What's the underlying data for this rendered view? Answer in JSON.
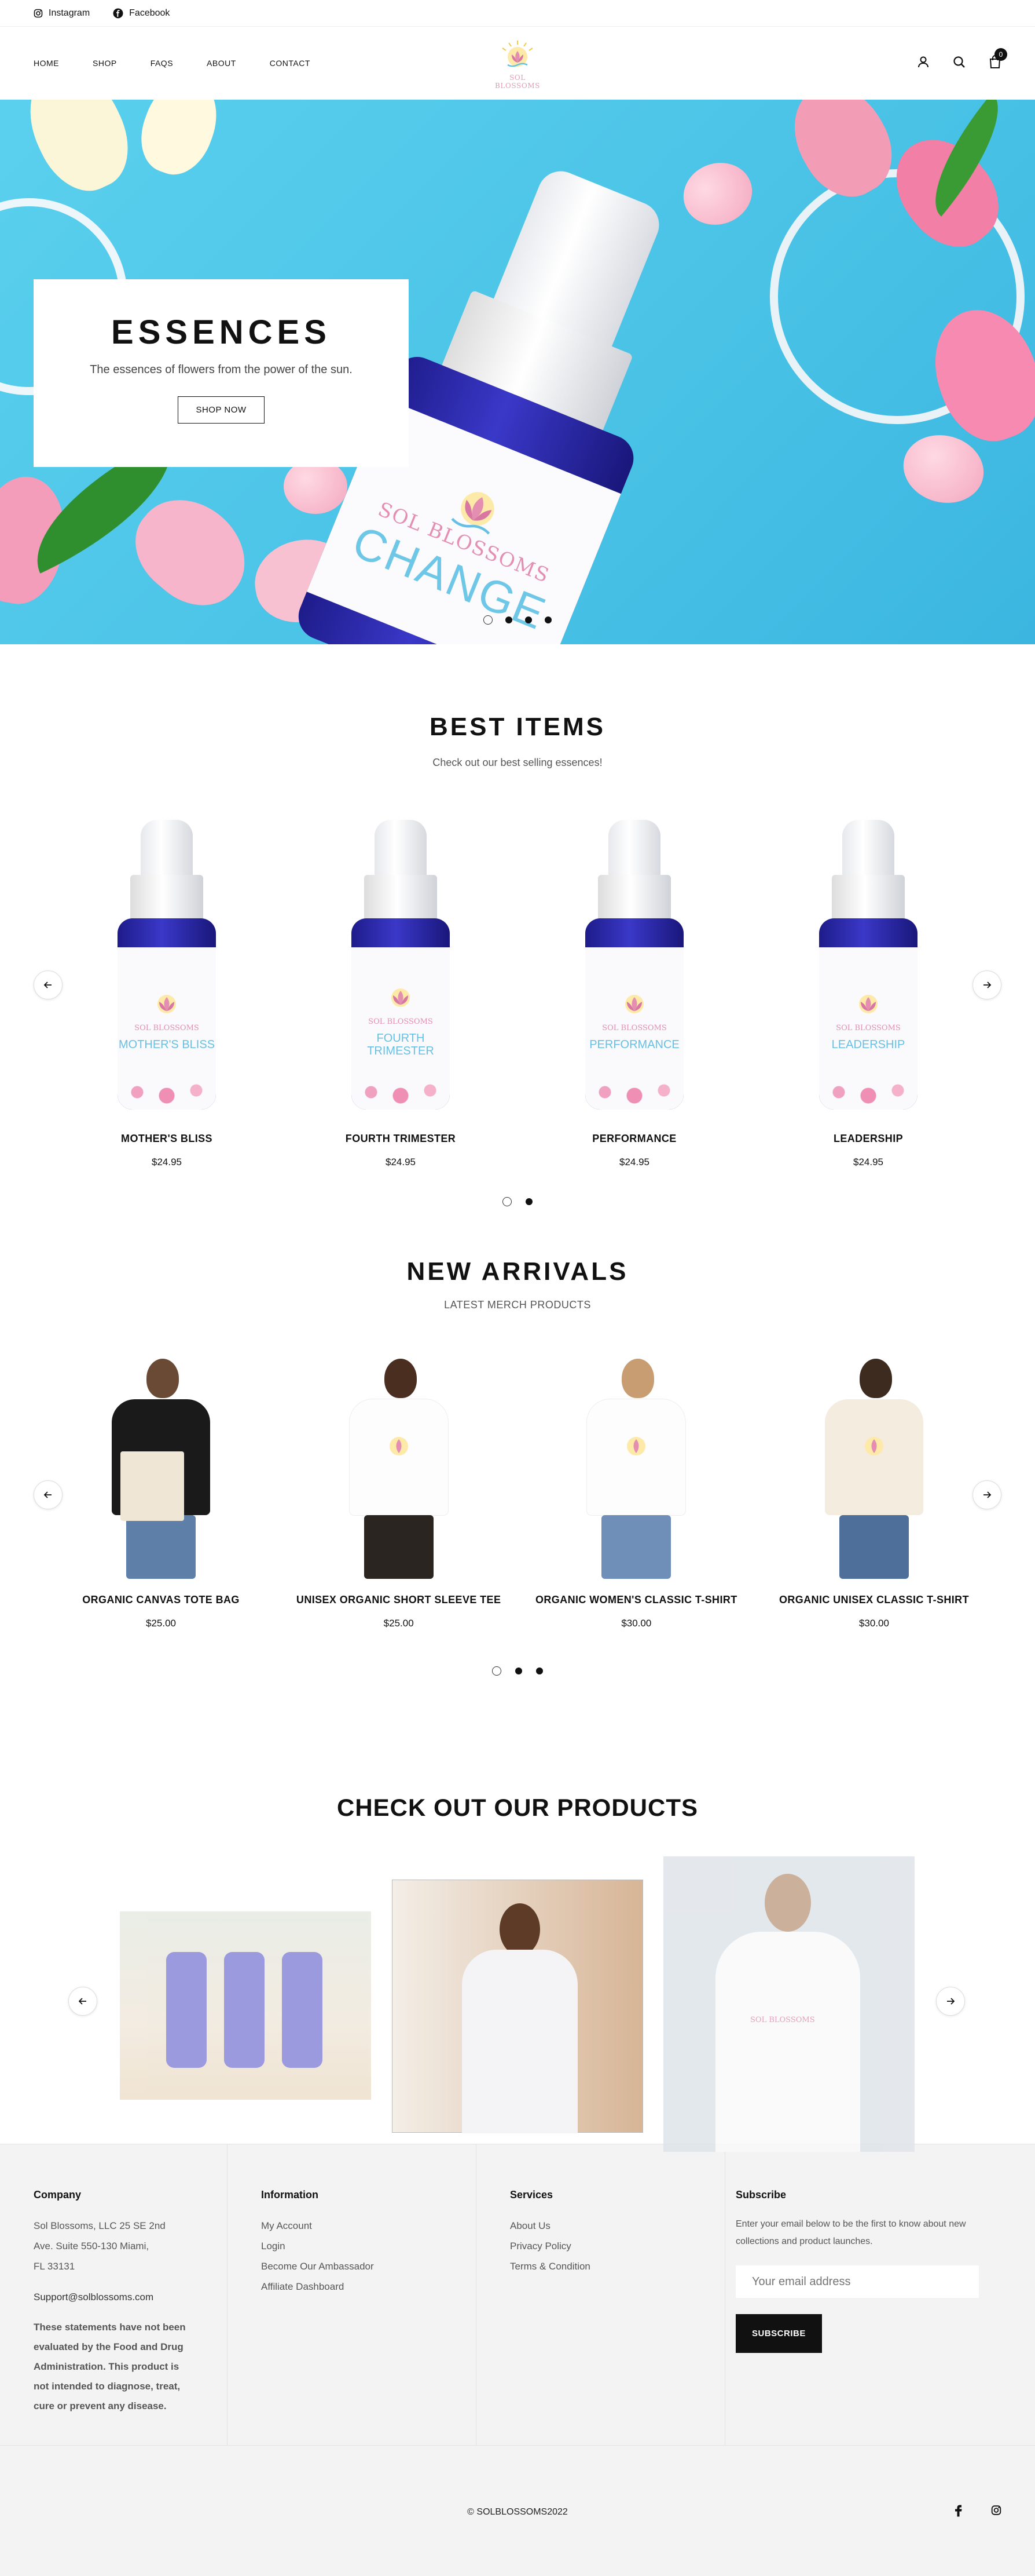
{
  "topbar": {
    "instagram": "Instagram",
    "facebook": "Facebook"
  },
  "nav": [
    "HOME",
    "SHOP",
    "FAQS",
    "ABOUT",
    "CONTACT"
  ],
  "logo": {
    "text": "SOL BLOSSOMS"
  },
  "cart": {
    "count": "0"
  },
  "hero": {
    "title": "ESSENCES",
    "subtitle": "The essences of flowers from the power of the sun.",
    "cta": "SHOP NOW",
    "bottle_brand": "SOL BLOSSOMS",
    "bottle_name": "CHANGE",
    "slides": 4,
    "active_slide": 1
  },
  "best": {
    "title": "BEST ITEMS",
    "subtitle": "Check out our best selling essences!",
    "products": [
      {
        "name": "MOTHER'S BLISS",
        "label": "MOTHER'S BLISS",
        "price": "$24.95"
      },
      {
        "name": "FOURTH TRIMESTER",
        "label": "FOURTH TRIMESTER",
        "price": "$24.95"
      },
      {
        "name": "PERFORMANCE",
        "label": "PERFORMANCE",
        "price": "$24.95"
      },
      {
        "name": "LEADERSHIP",
        "label": "LEADERSHIP",
        "price": "$24.95"
      }
    ],
    "bottle_brand": "SOL BLOSSOMS",
    "pages": 2,
    "active_page": 1
  },
  "arrivals": {
    "title": "NEW ARRIVALS",
    "subtitle": "LATEST MERCH PRODUCTS",
    "products": [
      {
        "name": "ORGANIC CANVAS TOTE BAG",
        "price": "$25.00"
      },
      {
        "name": "UNISEX ORGANIC SHORT SLEEVE TEE",
        "price": "$25.00"
      },
      {
        "name": "ORGANIC WOMEN'S CLASSIC T-SHIRT",
        "price": "$30.00"
      },
      {
        "name": "ORGANIC UNISEX CLASSIC T-SHIRT",
        "price": "$30.00"
      }
    ],
    "pages": 3,
    "active_page": 1
  },
  "featured": {
    "title": "CHECK OUT OUR PRODUCTS",
    "hoodie_brand": "SOL BLOSSOMS"
  },
  "footer": {
    "company": {
      "title": "Company",
      "address": [
        "Sol Blossoms, LLC 25 SE 2nd",
        "Ave. Suite 550-130 Miami,",
        "FL 33131"
      ],
      "email": "Support@solblossoms.com",
      "disclaimer": "These statements have not been evaluated by the Food and Drug Administration. This product is not intended to diagnose, treat, cure or prevent any disease."
    },
    "information": {
      "title": "Information",
      "links": [
        "My Account",
        "Login",
        "Become Our Ambassador",
        "Affiliate Dashboard"
      ]
    },
    "services": {
      "title": "Services",
      "links": [
        "About Us",
        "Privacy Policy",
        "Terms & Condition"
      ]
    },
    "subscribe": {
      "title": "Subscribe",
      "text": "Enter your email below to be the first to know about new collections and product launches.",
      "placeholder": "Your email address",
      "button": "SUBSCRIBE"
    },
    "copyright": "© SOLBLOSSOMS2022"
  },
  "colors": {
    "accent": "#111111",
    "pink": "#e48fb1",
    "sky": "#49c2e6",
    "bottle_blue": "#2b29b0"
  }
}
